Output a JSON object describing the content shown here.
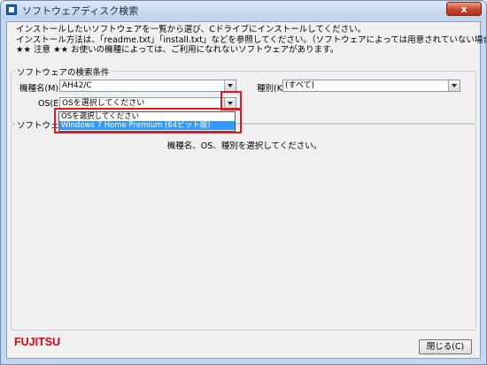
{
  "window": {
    "title": "ソフトウェアディスク検索",
    "close_symbol": "x"
  },
  "intro": [
    "インストールしたいソフトウェアを一覧から選び、Cドライブにインストールしてください。",
    "インストール方法は、「readme.txt」「install.txt」などを参照してください。（ソフトウェアによっては用意されていない場合もあります）",
    "★★ 注意 ★★ お使いの機種によっては、ご利用になれないソフトウェアがあります。"
  ],
  "search": {
    "group_label": "ソフトウェアの検索条件",
    "model_label": "機種名(M)",
    "model_value": "AH42/C",
    "kind_label": "種別(K)",
    "kind_value": "(すべて)",
    "os_label": "OS(E)",
    "os_value": "OSを選択してください",
    "os_options": [
      "OSを選択してください",
      "Windows 7 Home Premium (64ビット版)"
    ]
  },
  "results": {
    "group_label": "ソフトウェア一覧",
    "message": "機種名、OS、種別を選択してください。"
  },
  "footer": {
    "logo_text": "FUJITSU",
    "close_label": "閉じる(C)"
  },
  "colors": {
    "highlight": "#e8171e",
    "selection": "#3399ff",
    "logo": "#e60012"
  }
}
